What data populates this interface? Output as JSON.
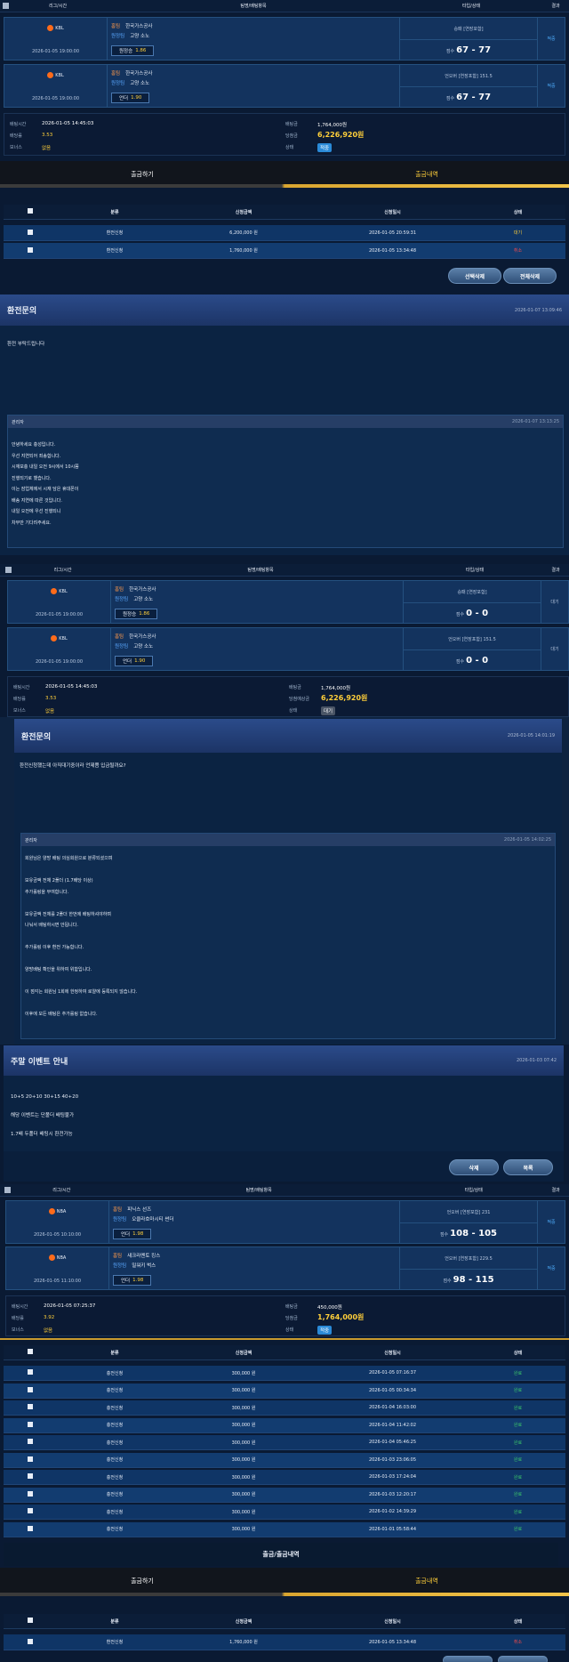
{
  "header1": {
    "league_time": "리그/시간",
    "bet_items": "팀명/배팅항목",
    "type_status": "타입/상태",
    "result": "결과"
  },
  "bets1": [
    {
      "league": "KBL",
      "date": "2026-01-05 19:00:00",
      "home_tag": "홈팀",
      "home": "한국가스공사",
      "away_tag": "원정팀",
      "away": "고양 소노",
      "pick": "원정승",
      "odds": "1.86",
      "type": "승패 [연장포함]",
      "score_label": "점수",
      "score": "67 - 77",
      "result": "적중"
    },
    {
      "league": "KBL",
      "date": "2026-01-05 19:00:00",
      "home_tag": "홈팀",
      "home": "한국가스공사",
      "away_tag": "원정팀",
      "away": "고양 소노",
      "pick": "언더",
      "odds": "1.90",
      "type": "언오버 [연장포함] 151.5",
      "score_label": "점수",
      "score": "67 - 77",
      "result": "적중"
    }
  ],
  "summary1": {
    "bet_time_label": "배팅시간",
    "bet_time": "2026-01-05 14:45:03",
    "odds_label": "배당률",
    "odds": "3.53",
    "bonus_label": "보너스",
    "bonus": "없음",
    "amount_label": "배팅금",
    "amount": "1,764,000원",
    "win_label": "당첨금",
    "win": "6,226,920원",
    "status_label": "상태",
    "status": "적중"
  },
  "tabs1": {
    "withdraw": "출금하기",
    "history": "출금내역"
  },
  "table1": {
    "headers": [
      "분류",
      "신청금액",
      "신청일시",
      "상태"
    ],
    "rows": [
      {
        "type": "환전신청",
        "amount": "6,200,000 원",
        "datetime": "2026-01-05 20:59:31",
        "status": "대기"
      },
      {
        "type": "환전신청",
        "amount": "1,760,000 원",
        "datetime": "2026-01-05 13:34:48",
        "status": "취소"
      }
    ],
    "btn_delete_selected": "선택삭제",
    "btn_delete_all": "전체삭제"
  },
  "inquiry1": {
    "title": "환전문의",
    "date": "2026-01-07 13:09:46",
    "body": "환전 부탁드립니다",
    "reply_author": "관리자",
    "reply_date": "2026-01-07 13:13:25",
    "reply_lines": [
      "안녕하세요 충성입니다.",
      "우선 지연되어 죄송합니다.",
      "시재보충 내일 오전 9시에서 10시쯤",
      "진행되기로 했습니다.",
      "이는 잠업체에서 시재 담은 휴대폰이",
      "배송 지연에 따른 것입니다.",
      "내일 오전에 우선 진행되니",
      "차부만 기다려주세요."
    ]
  },
  "header2": {
    "league_time": "리그/시간",
    "bet_items": "팀명/배팅항목",
    "type_status": "타입/상태",
    "result": "결과"
  },
  "bets2": [
    {
      "league": "KBL",
      "date": "2026-01-05 19:00:00",
      "home_tag": "홈팀",
      "home": "한국가스공사",
      "away_tag": "원정팀",
      "away": "고양 소노",
      "pick": "원정승",
      "odds": "1.86",
      "type": "승패 [연장포함]",
      "score_label": "점수",
      "score": "0 - 0",
      "result": "대기"
    },
    {
      "league": "KBL",
      "date": "2026-01-05 19:00:00",
      "home_tag": "홈팀",
      "home": "한국가스공사",
      "away_tag": "원정팀",
      "away": "고양 소노",
      "pick": "언더",
      "odds": "1.90",
      "type": "언오버 [연장포함] 151.5",
      "score_label": "점수",
      "score": "0 - 0",
      "result": "대기"
    }
  ],
  "summary2": {
    "bet_time_label": "배팅시간",
    "bet_time": "2026-01-05 14:45:03",
    "odds_label": "배당률",
    "odds": "3.53",
    "bonus_label": "보너스",
    "bonus": "없음",
    "amount_label": "배팅금",
    "amount": "1,764,000원",
    "win_label": "당첨예상금",
    "win": "6,226,920원",
    "status_label": "상태",
    "status": "대기"
  },
  "inquiry2": {
    "title": "환전문의",
    "date": "2026-01-05 14:01:19",
    "body": "환전신청했는데 아직대기중이라 언제쯤 입금될까요?",
    "reply_author": "관리자",
    "reply_date": "2026-01-05 14:02:25",
    "reply_lines": [
      "회원님은 양방 배팅 의심회원으로 분류되셨으며",
      "",
      "보유금액 전체 2폴더 (1.7배당 이상)",
      "추가롤링을 부여합니다.",
      "",
      "보유금액 전체를 2폴더 한번에 배팅하셔야하며",
      "나눠서 배팅하시면 안됩니다.",
      "",
      "추가롤링 이후 환전 가능합니다.",
      "",
      "양방배팅 확인을 위하여 위함입니다.",
      "",
      "이 점각는 회원님 1회에 한정하여 로얄에 등록되지 않습니다.",
      "",
      "이후에 모든 배팅은 추가롤링 없습니다."
    ]
  },
  "event": {
    "title": "주말 이벤트 안내",
    "date": "2026-01-03 07:42",
    "lines": [
      "10+5 20+10 30+15 40+20",
      "해당 이벤트는 단폴더 배팅불가",
      "1.7배 두폴더 배팅시 환전가능"
    ],
    "btn_delete": "삭제",
    "btn_list": "목록"
  },
  "header3": {
    "league_time": "리그/시간",
    "bet_items": "팀명/배팅항목",
    "type_status": "타입/상태",
    "result": "결과"
  },
  "bets3": [
    {
      "league": "NBA",
      "date": "2026-01-05 10:10:00",
      "home_tag": "홈팀",
      "home": "피닉스 선즈",
      "away_tag": "원정팀",
      "away": "오클라호마시티 썬더",
      "pick": "언더",
      "odds": "1.98",
      "type": "언오버 [연장포함] 231",
      "score_label": "점수",
      "score": "108 - 105",
      "result": "적중"
    },
    {
      "league": "NBA",
      "date": "2026-01-05 11:10:00",
      "home_tag": "홈팀",
      "home": "새크라멘토 킹스",
      "away_tag": "원정팀",
      "away": "밀워키 벅스",
      "pick": "언더",
      "odds": "1.98",
      "type": "언오버 [연장포함] 229.5",
      "score_label": "점수",
      "score": "98 - 115",
      "result": "적중"
    }
  ],
  "summary3": {
    "bet_time_label": "배팅시간",
    "bet_time": "2026-01-05 07:25:37",
    "odds_label": "배당률",
    "odds": "3.92",
    "bonus_label": "보너스",
    "bonus": "없음",
    "amount_label": "배팅금",
    "amount": "450,000원",
    "win_label": "당첨금",
    "win": "1,764,000원",
    "status_label": "상태",
    "status": "적중"
  },
  "table2": {
    "headers": [
      "분류",
      "신청금액",
      "신청일시",
      "상태"
    ],
    "rows": [
      {
        "type": "충전신청",
        "amount": "300,000 원",
        "datetime": "2026-01-05 07:16:37",
        "status": "완료"
      },
      {
        "type": "충전신청",
        "amount": "300,000 원",
        "datetime": "2026-01-05 00:34:34",
        "status": "완료"
      },
      {
        "type": "충전신청",
        "amount": "300,000 원",
        "datetime": "2026-01-04 16:03:00",
        "status": "완료"
      },
      {
        "type": "충전신청",
        "amount": "300,000 원",
        "datetime": "2026-01-04 11:42:02",
        "status": "완료"
      },
      {
        "type": "충전신청",
        "amount": "300,000 원",
        "datetime": "2026-01-04 05:46:25",
        "status": "완료"
      },
      {
        "type": "충전신청",
        "amount": "300,000 원",
        "datetime": "2026-01-03 23:06:05",
        "status": "완료"
      },
      {
        "type": "충전신청",
        "amount": "300,000 원",
        "datetime": "2026-01-03 17:24:04",
        "status": "완료"
      },
      {
        "type": "충전신청",
        "amount": "300,000 원",
        "datetime": "2026-01-03 12:20:17",
        "status": "완료"
      },
      {
        "type": "충전신청",
        "amount": "300,000 원",
        "datetime": "2026-01-02 14:39:29",
        "status": "완료"
      },
      {
        "type": "충전신청",
        "amount": "300,000 원",
        "datetime": "2026-01-01 05:58:44",
        "status": "완료"
      }
    ]
  },
  "section2": {
    "title": "출금/출금내역"
  },
  "tabs2": {
    "withdraw": "출금하기",
    "history": "출금내역"
  },
  "table3": {
    "headers": [
      "분류",
      "신청금액",
      "신청일시",
      "상태"
    ],
    "rows": [
      {
        "type": "환전신청",
        "amount": "1,760,000 원",
        "datetime": "2026-01-05 13:34:48",
        "status": "취소"
      }
    ]
  }
}
